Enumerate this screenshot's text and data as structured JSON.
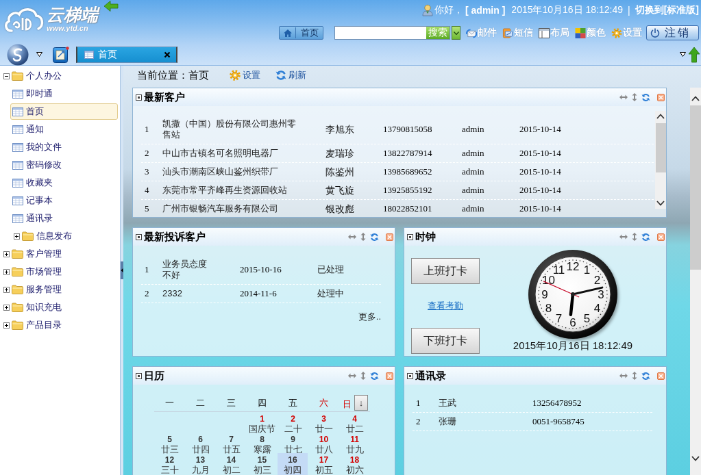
{
  "header": {
    "logo_name": "云梯端",
    "logo_url": "www.ytd.cn",
    "greeting": "你好，",
    "user": "[ admin ]",
    "datetime": "2015年10月16日 18:12:49",
    "divider": "|",
    "switch_link": "切换到[标准版]"
  },
  "toolbar": {
    "home_button": "首页",
    "search_button": "搜索",
    "links": [
      {
        "label": "邮件"
      },
      {
        "label": "短信"
      },
      {
        "label": "布局"
      },
      {
        "label": "颜色"
      },
      {
        "label": "设置"
      }
    ],
    "logout_button": "注销"
  },
  "tabs": [
    {
      "label": "首页",
      "selected": true
    }
  ],
  "sidebar": {
    "items": [
      {
        "label": "个人办公",
        "kind": "folder",
        "expanded": true,
        "selected": false,
        "children": [
          {
            "label": "即时通",
            "kind": "page",
            "selected": false
          },
          {
            "label": "首页",
            "kind": "page",
            "selected": true
          },
          {
            "label": "通知",
            "kind": "page",
            "selected": false
          },
          {
            "label": "我的文件",
            "kind": "page",
            "selected": false
          },
          {
            "label": "密码修改",
            "kind": "page",
            "selected": false
          },
          {
            "label": "收藏夹",
            "kind": "page",
            "selected": false
          },
          {
            "label": "记事本",
            "kind": "page",
            "selected": false
          },
          {
            "label": "通讯录",
            "kind": "page",
            "selected": false
          },
          {
            "label": "信息发布",
            "kind": "folder",
            "expanded": false,
            "selected": false
          }
        ]
      },
      {
        "label": "客户管理",
        "kind": "folder",
        "expanded": false,
        "selected": false
      },
      {
        "label": "市场管理",
        "kind": "folder",
        "expanded": false,
        "selected": false
      },
      {
        "label": "服务管理",
        "kind": "folder",
        "expanded": false,
        "selected": false
      },
      {
        "label": "知识充电",
        "kind": "folder",
        "expanded": false,
        "selected": false
      },
      {
        "label": "产品目录",
        "kind": "folder",
        "expanded": false,
        "selected": false
      }
    ]
  },
  "breadcrumb": {
    "location": "当前位置：首页",
    "actions": [
      {
        "label": "设置"
      },
      {
        "label": "刷新"
      }
    ]
  },
  "latest_customers": {
    "title": "最新客户",
    "rows": [
      [
        "1",
        "凯撒（中国）股份有限公司惠州零售站",
        "李旭东",
        "13790815058",
        "admin",
        "2015-10-14"
      ],
      [
        "2",
        "中山市古镇名可名照明电器厂",
        "麦瑞珍",
        "13822787914",
        "admin",
        "2015-10-14"
      ],
      [
        "3",
        "汕头市潮南区峡山鉴州织带厂",
        "陈鉴州",
        "13985689652",
        "admin",
        "2015-10-14"
      ],
      [
        "4",
        "东莞市常平齐峰再生资源回收站",
        "黄飞旋",
        "13925855192",
        "admin",
        "2015-10-14"
      ],
      [
        "5",
        "广州市银畅汽车服务有限公司",
        "银改彪",
        "18022852101",
        "admin",
        "2015-10-14"
      ]
    ]
  },
  "latest_complaints": {
    "title": "最新投诉客户",
    "rows": [
      [
        "1",
        "业务员态度不好",
        "2015-10-16",
        "已处理"
      ],
      [
        "2",
        "2332",
        "2014-11-6",
        "处理中"
      ]
    ],
    "more_link": "更多.."
  },
  "clock": {
    "title": "时钟",
    "check_in_button": "上班打卡",
    "attendance_link": "查看考勤",
    "check_out_button": "下班打卡",
    "dial": [
      "11",
      "12",
      "1",
      "10",
      "2",
      "9",
      "3",
      "8",
      "4",
      "7",
      "6",
      "5"
    ],
    "datetime": "2015年10月16日 18:12:49"
  },
  "calendar": {
    "title": "日历",
    "weekdays": [
      {
        "label": "一",
        "weekend": false
      },
      {
        "label": "二",
        "weekend": false
      },
      {
        "label": "三",
        "weekend": false
      },
      {
        "label": "四",
        "weekend": false
      },
      {
        "label": "五",
        "weekend": false
      },
      {
        "label": "六",
        "weekend": true
      },
      {
        "label": "日",
        "weekend": true
      }
    ],
    "toggle_button": "↓",
    "weeks": [
      [
        {
          "day": "1",
          "lunar": "国庆节",
          "rest_day": true,
          "selected": false
        },
        {
          "day": "2",
          "lunar": "二十",
          "rest_day": true,
          "selected": false
        },
        {
          "day": "3",
          "lunar": "廿一",
          "rest_day": true,
          "selected": false
        },
        {
          "day": "4",
          "lunar": "廿二",
          "rest_day": true,
          "selected": false
        }
      ],
      [
        {
          "day": "5",
          "lunar": "廿三",
          "rest_day": false,
          "selected": false
        },
        {
          "day": "6",
          "lunar": "廿四",
          "rest_day": false,
          "selected": false
        },
        {
          "day": "7",
          "lunar": "廿五",
          "rest_day": false,
          "selected": false
        },
        {
          "day": "8",
          "lunar": "寒露",
          "rest_day": false,
          "selected": false
        },
        {
          "day": "9",
          "lunar": "廿七",
          "rest_day": false,
          "selected": false
        },
        {
          "day": "10",
          "lunar": "廿八",
          "rest_day": true,
          "selected": false
        },
        {
          "day": "11",
          "lunar": "廿九",
          "rest_day": true,
          "selected": false
        }
      ],
      [
        {
          "day": "12",
          "lunar": "三十",
          "rest_day": false,
          "selected": false
        },
        {
          "day": "13",
          "lunar": "九月",
          "rest_day": false,
          "selected": false
        },
        {
          "day": "14",
          "lunar": "初二",
          "rest_day": false,
          "selected": false
        },
        {
          "day": "15",
          "lunar": "初三",
          "rest_day": false,
          "selected": false
        },
        {
          "day": "16",
          "lunar": "初四",
          "rest_day": false,
          "selected": true
        },
        {
          "day": "17",
          "lunar": "初五",
          "rest_day": true,
          "selected": false
        },
        {
          "day": "18",
          "lunar": "初六",
          "rest_day": true,
          "selected": false
        }
      ]
    ]
  },
  "contacts": {
    "title": "通讯录",
    "rows": [
      [
        "1",
        "王武",
        "13256478952"
      ],
      [
        "2",
        "张珊",
        "0051-9658745"
      ]
    ]
  }
}
